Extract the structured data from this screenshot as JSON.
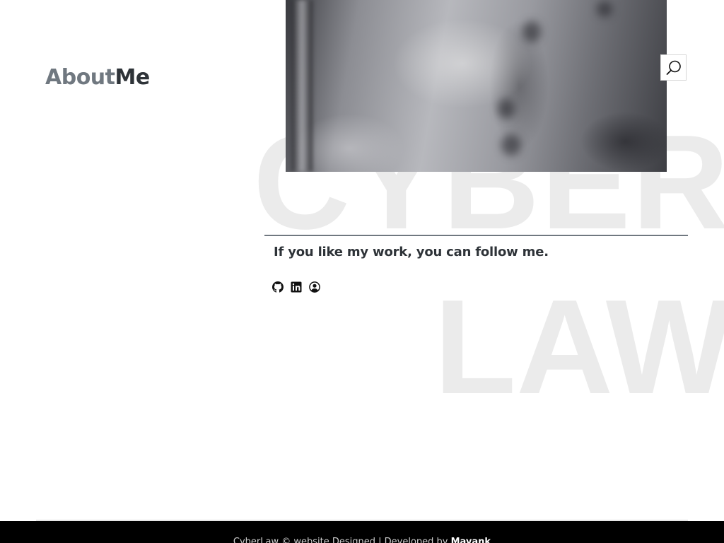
{
  "header": {
    "title_part1": "About",
    "title_part2": "Me"
  },
  "background_words": {
    "word1": "CYBER",
    "word2": "LAW"
  },
  "search": {
    "icon": "search-icon"
  },
  "follow": {
    "text": "If you like my work, you can follow me."
  },
  "socials": [
    {
      "icon": "github-icon"
    },
    {
      "icon": "linkedin-icon"
    },
    {
      "icon": "user-circle-icon"
    }
  ],
  "footer": {
    "text": "CyberLaw © website Designed | Developed by ",
    "developer": "Mayank"
  },
  "colors": {
    "accent_grey": "#707880",
    "text_dark": "#2e3338",
    "footer_bg": "#000000"
  }
}
